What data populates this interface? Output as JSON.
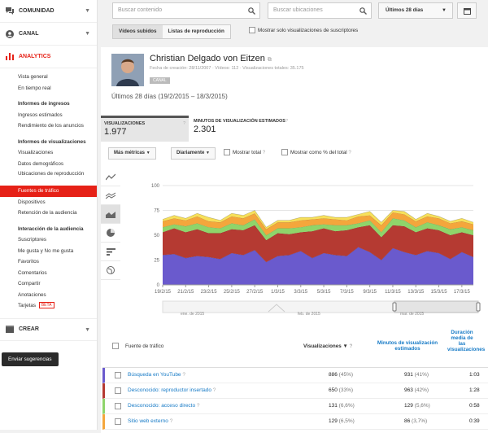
{
  "sidebar": {
    "sections": {
      "comunidad": "COMUNIDAD",
      "canal": "CANAL",
      "analytics": "ANALYTICS",
      "crear": "CREAR"
    },
    "items": {
      "vista_general": "Vista general",
      "en_tiempo_real": "En tiempo real",
      "informes_ingresos": "Informes de ingresos",
      "ingresos_estimados": "Ingresos estimados",
      "rendimiento_anuncios": "Rendimiento de los anuncios",
      "informes_visualizaciones": "Informes de visualizaciones",
      "visualizaciones": "Visualizaciones",
      "datos_demograficos": "Datos demográficos",
      "ubicaciones": "Ubicaciones de reproducción",
      "fuentes_trafico": "Fuentes de tráfico",
      "dispositivos": "Dispositivos",
      "retencion": "Retención de la audiencia",
      "interaccion": "Interacción de la audiencia",
      "suscriptores": "Suscriptores",
      "me_gusta": "Me gusta y No me gusta",
      "favoritos": "Favoritos",
      "comentarios": "Comentarios",
      "compartir": "Compartir",
      "anotaciones": "Anotaciones",
      "tarjetas": "Tarjetas",
      "beta": "BETA"
    },
    "feedback": "Enviar sugerencias"
  },
  "topbar": {
    "search_content": "Buscar contenido",
    "search_locations": "Buscar ubicaciones",
    "date_range": "Últimos 28 días",
    "tab_uploaded": "Vídeos subidos",
    "tab_playlists": "Listas de reproducción",
    "subs_only": "Mostrar solo visualizaciones de suscriptores"
  },
  "channel": {
    "name": "Christian Delgado von Eitzen",
    "meta": "Fecha de creación: 28/11/2007  ·  Vídeos: 112  ·  Visualizaciones totales: 35.175",
    "badge": "CANAL",
    "range": "Últimos 28 días (19/2/2015 – 18/3/2015)"
  },
  "metrics": {
    "views_label": "VISUALIZACIONES",
    "views_value": "1.977",
    "minutes_label": "MINUTOS DE VISUALIZACIÓN ESTIMADOS",
    "minutes_value": "2.301"
  },
  "toolbar": {
    "more_metrics": "Más métricas",
    "daily": "Diariamente",
    "show_total": "Mostrar total",
    "show_pct": "Mostrar como % del total"
  },
  "chart_data": {
    "type": "area",
    "stacked": true,
    "x": [
      "19/2/15",
      "20/2/15",
      "21/2/15",
      "22/2/15",
      "23/2/15",
      "24/2/15",
      "25/2/15",
      "26/2/15",
      "27/2/15",
      "28/2/15",
      "1/3/15",
      "2/3/15",
      "3/3/15",
      "4/3/15",
      "5/3/15",
      "6/3/15",
      "7/3/15",
      "8/3/15",
      "9/3/15",
      "10/3/15",
      "11/3/15",
      "12/3/15",
      "13/3/15",
      "14/3/15",
      "15/3/15",
      "16/3/15",
      "17/3/15",
      "18/3/15"
    ],
    "xtick_labels": [
      "19/2/15",
      "21/2/15",
      "23/2/15",
      "25/2/15",
      "27/2/15",
      "1/3/15",
      "3/3/15",
      "5/3/15",
      "7/3/15",
      "9/3/15",
      "11/3/15",
      "13/3/15",
      "15/3/15",
      "17/3/15"
    ],
    "ylim": [
      0,
      100
    ],
    "yticks": [
      0,
      25,
      50,
      75,
      100
    ],
    "grid": true,
    "series": [
      {
        "name": "Búsqueda en YouTube",
        "color": "#6a5acd",
        "values": [
          30,
          31,
          27,
          29,
          28,
          26,
          32,
          30,
          35,
          23,
          29,
          30,
          34,
          27,
          32,
          30,
          29,
          38,
          33,
          25,
          37,
          33,
          30,
          34,
          32,
          26,
          33,
          28
        ]
      },
      {
        "name": "Desconocido: reproductor insertado",
        "color": "#b53a32",
        "values": [
          23,
          26,
          26,
          27,
          24,
          26,
          24,
          25,
          25,
          22,
          23,
          21,
          19,
          27,
          25,
          24,
          26,
          20,
          27,
          23,
          23,
          26,
          23,
          23,
          23,
          24,
          20,
          22
        ]
      },
      {
        "name": "Desconocido: acceso directo",
        "color": "#8fd46a",
        "values": [
          5,
          4,
          6,
          6,
          6,
          5,
          6,
          5,
          6,
          5,
          5,
          6,
          5,
          6,
          4,
          6,
          5,
          4,
          5,
          5,
          7,
          6,
          5,
          6,
          5,
          6,
          5,
          5
        ]
      },
      {
        "name": "Sitio web externo",
        "color": "#f4a63c",
        "values": [
          6,
          6,
          6,
          7,
          6,
          6,
          7,
          7,
          6,
          6,
          6,
          6,
          7,
          6,
          6,
          6,
          5,
          7,
          5,
          7,
          6,
          6,
          6,
          6,
          7,
          6,
          6,
          6
        ]
      },
      {
        "name": "",
        "color": "#f7e05a",
        "values": [
          2,
          3,
          2,
          3,
          4,
          2,
          3,
          3,
          3,
          2,
          2,
          2,
          3,
          2,
          3,
          2,
          3,
          2,
          4,
          3,
          2,
          3,
          2,
          3,
          2,
          2,
          3,
          2
        ]
      }
    ]
  },
  "timeline": {
    "left_label": "ene. de 2015",
    "mid_label": "feb. de 2015",
    "right_label": "mar. de 2015"
  },
  "table": {
    "col_source": "Fuente de tráfico",
    "col_views": "Visualizaciones",
    "col_minutes": "Minutos de visualización estimados",
    "col_duration": "Duración media de las visualizaciones",
    "rows": [
      {
        "name": "Búsqueda en YouTube",
        "views": "886",
        "views_pct": "(45%)",
        "minutes": "931",
        "minutes_pct": "(41%)",
        "duration": "1:03",
        "color": "#6a5acd"
      },
      {
        "name": "Desconocido: reproductor insertado",
        "views": "650",
        "views_pct": "(33%)",
        "minutes": "963",
        "minutes_pct": "(42%)",
        "duration": "1:28",
        "color": "#b53a32"
      },
      {
        "name": "Desconocido: acceso directo",
        "views": "131",
        "views_pct": "(6,6%)",
        "minutes": "129",
        "minutes_pct": "(5,6%)",
        "duration": "0:58",
        "color": "#8fd46a"
      },
      {
        "name": "Sitio web externo",
        "views": "129",
        "views_pct": "(6,5%)",
        "minutes": "86",
        "minutes_pct": "(3,7%)",
        "duration": "0:39",
        "color": "#f4a63c"
      }
    ]
  }
}
